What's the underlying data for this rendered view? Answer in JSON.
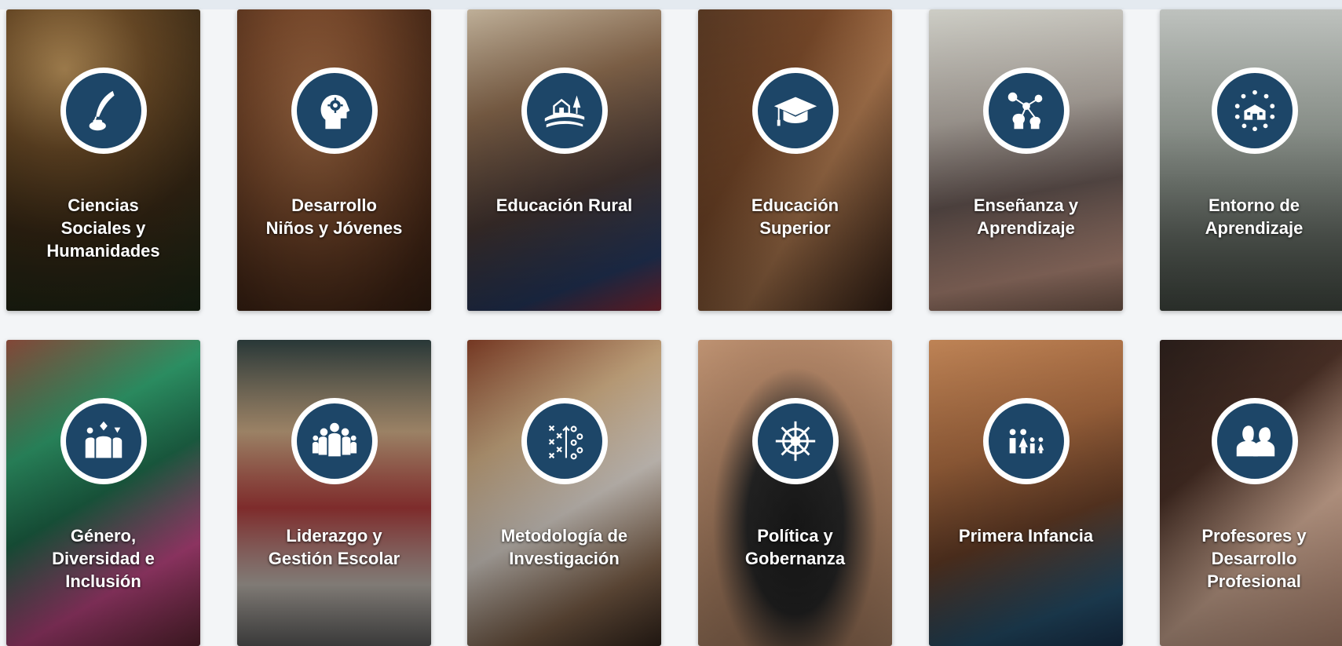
{
  "colors": {
    "icon_disc": "#1d4668",
    "icon_ring": "#ffffff",
    "label_text": "#ffffff"
  },
  "cards": [
    {
      "icon": "quill-inkwell-icon",
      "lines": [
        "Ciencias",
        "Sociales y",
        "Humanidades"
      ]
    },
    {
      "icon": "head-gear-icon",
      "lines": [
        "Desarrollo",
        "Niños y Jóvenes"
      ]
    },
    {
      "icon": "rural-house-icon",
      "lines": [
        "Educación Rural"
      ]
    },
    {
      "icon": "graduation-cap-icon",
      "lines": [
        "Educación",
        "Superior"
      ]
    },
    {
      "icon": "network-heads-icon",
      "lines": [
        "Enseñanza y",
        "Aprendizaje"
      ]
    },
    {
      "icon": "school-building-icon",
      "lines": [
        "Entorno de",
        "Aprendizaje"
      ]
    },
    {
      "icon": "diverse-people-icon",
      "lines": [
        "Género,",
        "Diversidad e",
        "Inclusión"
      ]
    },
    {
      "icon": "group-leader-icon",
      "lines": [
        "Liderazgo y",
        "Gestión Escolar"
      ]
    },
    {
      "icon": "strategy-chart-icon",
      "lines": [
        "Metodología de",
        "Investigación"
      ]
    },
    {
      "icon": "ship-wheel-icon",
      "lines": [
        "Política y",
        "Gobernanza"
      ]
    },
    {
      "icon": "family-icon",
      "lines": [
        "Primera Infancia"
      ]
    },
    {
      "icon": "teacher-pair-icon",
      "lines": [
        "Profesores y",
        "Desarrollo",
        "Profesional"
      ]
    }
  ]
}
